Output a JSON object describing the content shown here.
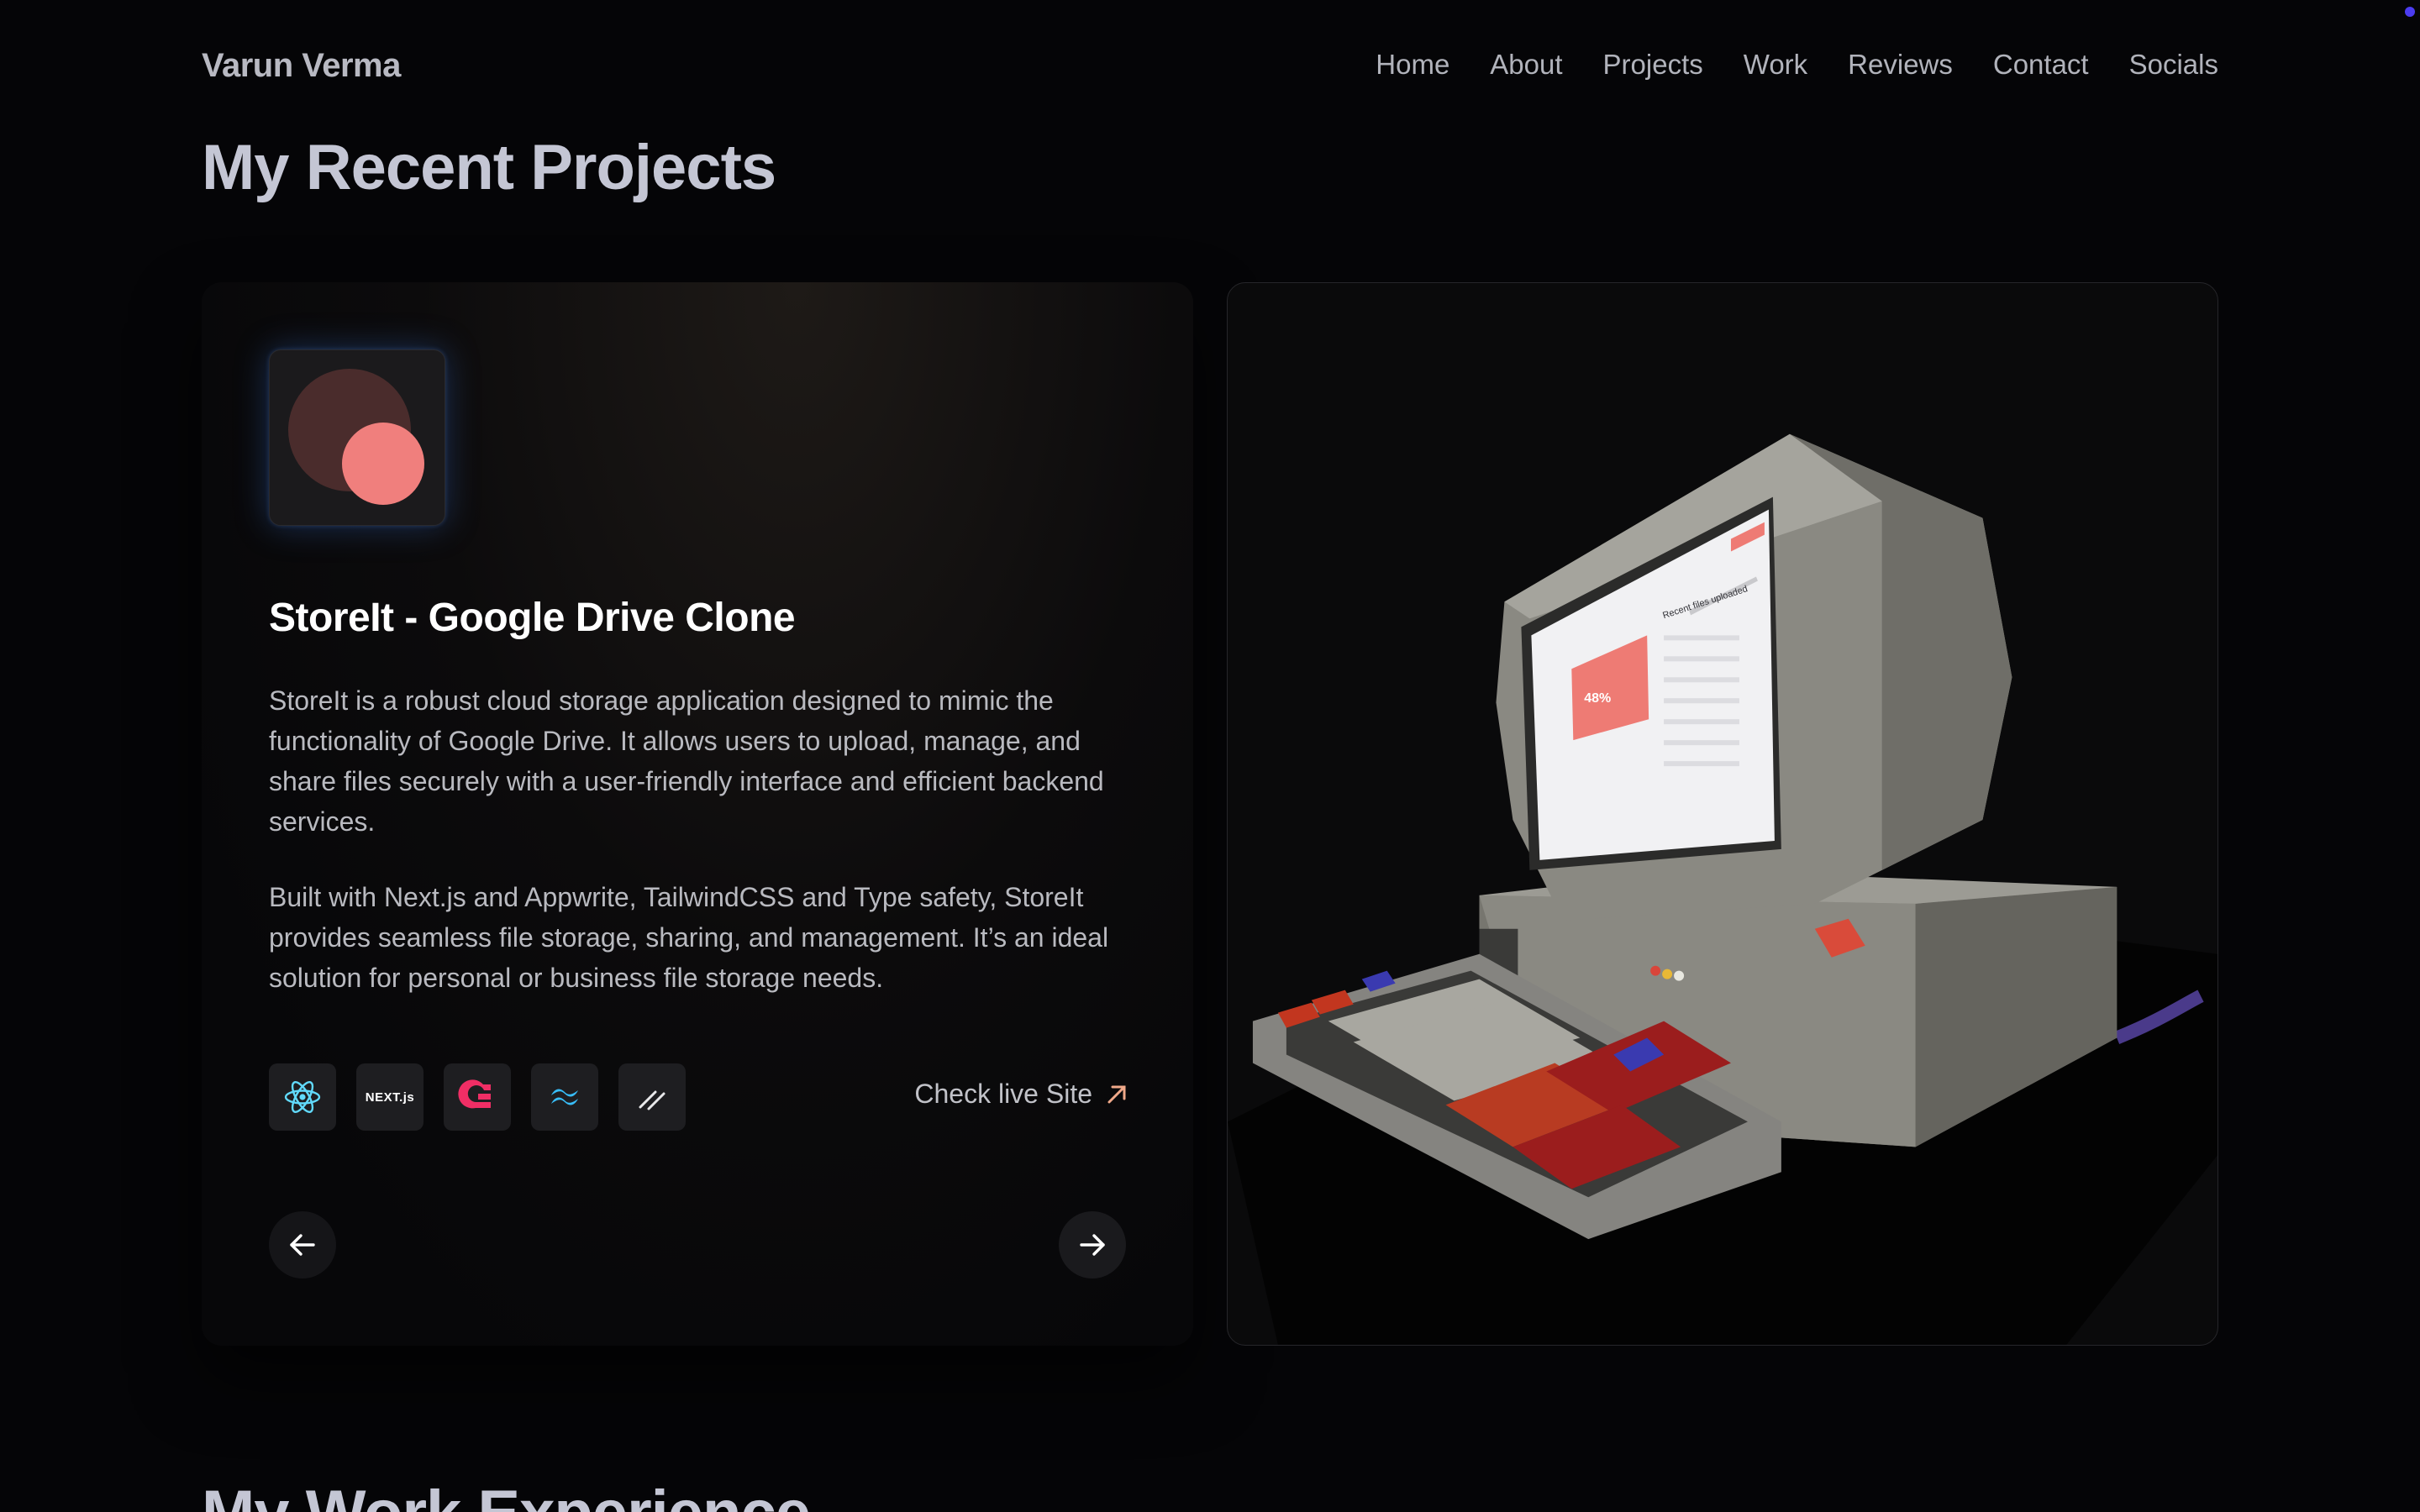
{
  "brand": "Varun Verma",
  "nav": {
    "items": [
      "Home",
      "About",
      "Projects",
      "Work",
      "Reviews",
      "Contact",
      "Socials"
    ]
  },
  "section_title": "My Recent Projects",
  "next_section_title": "My Work Experience",
  "project": {
    "title": "StoreIt - Google Drive Clone",
    "description_1": "StoreIt is a robust cloud storage application designed to mimic the functionality of Google Drive. It allows users to upload, manage, and share files securely with a user-friendly interface and efficient backend services.",
    "description_2": "Built with Next.js and Appwrite, TailwindCSS and Type safety, StoreIt provides seamless file storage, sharing, and management. It’s an ideal solution for personal or business file storage needs.",
    "tech_icons": [
      "react-icon",
      "nextjs-icon",
      "appwrite-icon",
      "tailwind-icon",
      "shadcn-icon"
    ],
    "next_logo_text": "NEXT.js",
    "live_label": "Check live Site",
    "screen_heading": "Recent files uploaded",
    "screen_stat": "48%"
  },
  "colors": {
    "background": "#050507",
    "accent_coral": "#f07f7d",
    "accent_dark_coral": "#4a2c2c",
    "text_primary": "#ffffff",
    "text_muted": "#b9bac0"
  }
}
